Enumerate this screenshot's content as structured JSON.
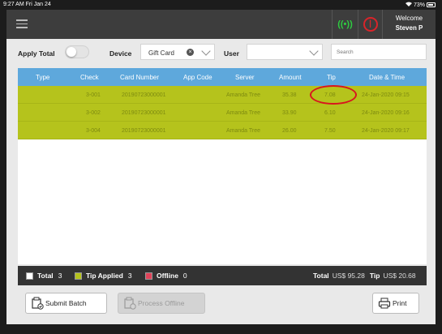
{
  "status_bar": {
    "time": "9:27 AM   Fri Jan 24",
    "battery": "73%"
  },
  "header": {
    "welcome": "Welcome",
    "username": "Steven P"
  },
  "filters": {
    "apply_total_label": "Apply Total",
    "device_label": "Device",
    "device_value": "Gift Card",
    "user_label": "User",
    "user_value": "",
    "search_placeholder": "Search"
  },
  "table": {
    "columns": [
      "Type",
      "Check",
      "Card Number",
      "App Code",
      "Server",
      "Amount",
      "Tip",
      "Date & Time"
    ],
    "rows": [
      {
        "type": "",
        "check": "3-001",
        "card": "20190723000001",
        "app_code": "",
        "server": "Amanda Tree",
        "amount": "35.38",
        "tip": "7.08",
        "datetime": "24-Jan-2020 09:15"
      },
      {
        "type": "",
        "check": "3-002",
        "card": "20190723000001",
        "app_code": "",
        "server": "Amanda Tree",
        "amount": "33.90",
        "tip": "6.10",
        "datetime": "24-Jan-2020 09:16"
      },
      {
        "type": "",
        "check": "3-004",
        "card": "20190723000001",
        "app_code": "",
        "server": "Amanda Tree",
        "amount": "26.00",
        "tip": "7.50",
        "datetime": "24-Jan-2020 09:17"
      }
    ]
  },
  "summary": {
    "total_label": "Total",
    "total_count": "3",
    "tip_applied_label": "Tip Applied",
    "tip_applied_count": "3",
    "offline_label": "Offline",
    "offline_count": "0",
    "grand_total_label": "Total",
    "grand_total_value": "US$ 95.28",
    "tip_label": "Tip",
    "tip_value": "US$ 20.68"
  },
  "buttons": {
    "submit_batch": "Submit Batch",
    "process_offline": "Process Offline",
    "print": "Print"
  },
  "colors": {
    "header_blue": "#5ea8dc",
    "row_olive": "#b5c31c",
    "offline_red": "#e0435a",
    "power_red": "#d9242a",
    "signal_green": "#2ecc40"
  }
}
